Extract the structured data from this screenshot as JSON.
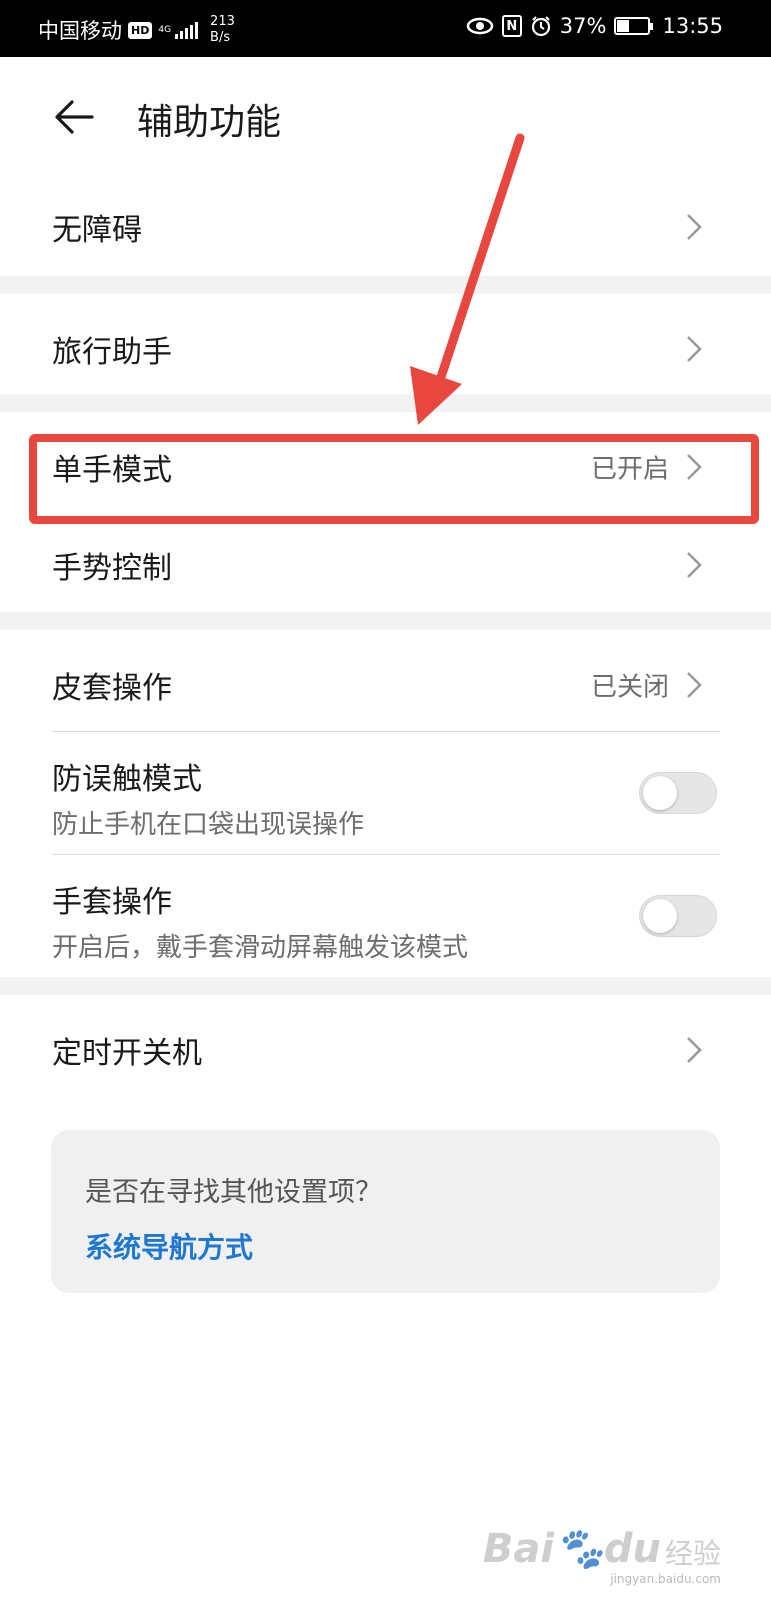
{
  "status_bar": {
    "carrier": "中国移动",
    "hd": "HD",
    "network": "4G",
    "net_speed_value": "213",
    "net_speed_unit": "B/s",
    "battery": "37%",
    "time": "13:55",
    "nfc": "N"
  },
  "header": {
    "title": "辅助功能"
  },
  "items": [
    {
      "label": "无障碍",
      "status": ""
    },
    {
      "label": "旅行助手",
      "status": ""
    },
    {
      "label": "单手模式",
      "status": "已开启"
    },
    {
      "label": "手势控制",
      "status": ""
    },
    {
      "label": "皮套操作",
      "status": "已关闭"
    },
    {
      "label": "防误触模式",
      "sub": "防止手机在口袋出现误操作",
      "toggle": false
    },
    {
      "label": "手套操作",
      "sub": "开启后，戴手套滑动屏幕触发该模式",
      "toggle": false
    },
    {
      "label": "定时开关机",
      "status": ""
    }
  ],
  "suggestion": {
    "question": "是否在寻找其他设置项？",
    "link": "系统导航方式"
  },
  "watermark": {
    "logo": "Bai",
    "logo_suffix": "du",
    "experience": "经验",
    "url": "jingyan.baidu.com"
  },
  "colors": {
    "annotation": "#e8473f",
    "link": "#1e78d2",
    "section_gap": "#f2f2f2"
  }
}
